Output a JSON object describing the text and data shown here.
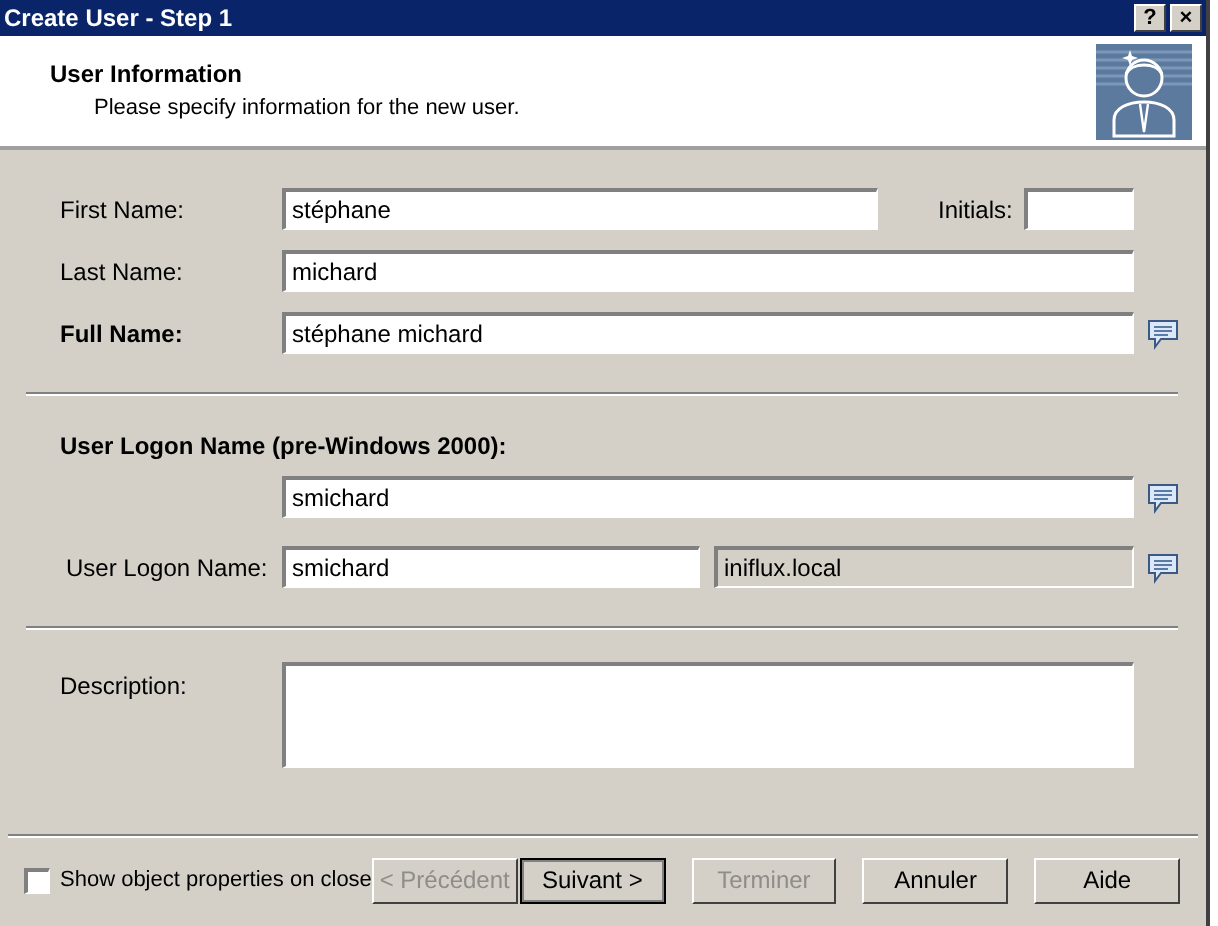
{
  "window": {
    "title": "Create User - Step 1",
    "controls": [
      "?",
      "×"
    ]
  },
  "header": {
    "title": "User Information",
    "subtitle": "Please specify information for the new user."
  },
  "first_name": {
    "label": "First Name:",
    "value": "stéphane"
  },
  "initials": {
    "label": "Initials:"
  },
  "last_name": {
    "label": "Last Name:",
    "value": "michard"
  },
  "full_name": {
    "label": "Full Name:",
    "value": "stéphane michard"
  },
  "logon_pre2000": {
    "heading": "User Logon Name (pre-Windows 2000):",
    "value": "smichard"
  },
  "logon": {
    "label": "User Logon Name:",
    "value": "smichard",
    "domain": "iniflux.local"
  },
  "description": {
    "label": "Description:"
  },
  "show_properties": {
    "label": "Show object properties on close",
    "checked": false
  },
  "buttons": [
    {
      "label": "< Précédent",
      "disabled": true,
      "default": false
    },
    {
      "label": "Suivant >",
      "disabled": false,
      "default": true
    },
    {
      "label": "Terminer",
      "disabled": true,
      "default": false
    },
    {
      "label": "Annuler",
      "disabled": false,
      "default": false
    },
    {
      "label": "Aide",
      "disabled": false,
      "default": false
    }
  ]
}
